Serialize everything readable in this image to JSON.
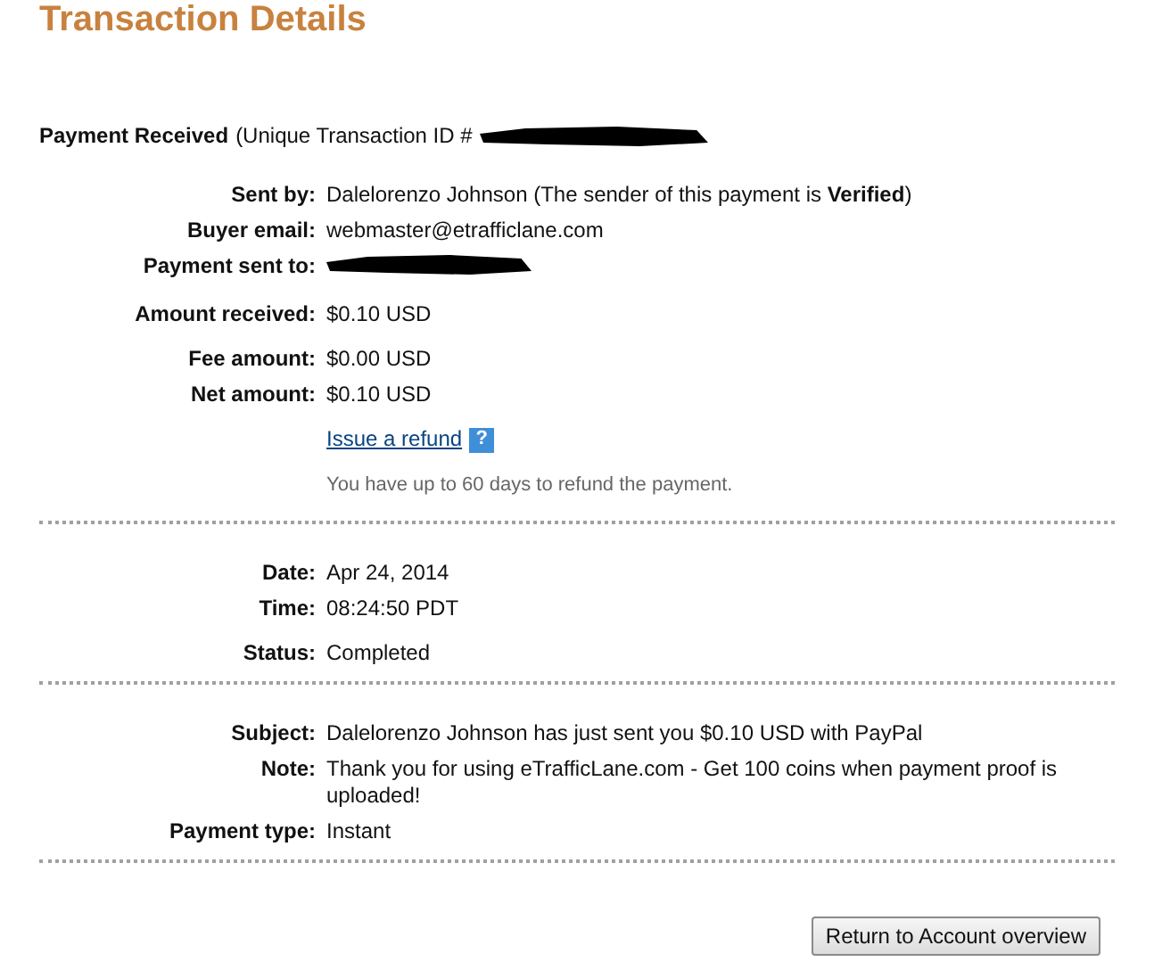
{
  "title": "Transaction Details",
  "header": {
    "label": "Payment Received",
    "text": "(Unique Transaction ID #",
    "redacted": true
  },
  "sections": [
    {
      "groups": [
        [
          {
            "label": "Sent by:",
            "kind": "text",
            "value": "Dalelorenzo Johnson (The sender of this payment is **Verified**)"
          },
          {
            "label": "Buyer email:",
            "kind": "text",
            "value": "webmaster@etrafficlane.com"
          },
          {
            "label": "Payment sent to:",
            "kind": "redacted"
          }
        ],
        [
          {
            "label": "Amount received:",
            "kind": "text",
            "value": "$0.10 USD"
          }
        ],
        [
          {
            "label": "Fee amount:",
            "kind": "text",
            "value": "$0.00 USD"
          },
          {
            "label": "Net amount:",
            "kind": "text",
            "value": "$0.10 USD"
          }
        ],
        [
          {
            "kind": "link",
            "value": "Issue a refund",
            "icon": "?"
          }
        ],
        [
          {
            "kind": "hint",
            "value": "You have up to 60 days to refund the payment."
          }
        ]
      ]
    },
    {
      "groups": [
        [
          {
            "label": "Date:",
            "kind": "text",
            "value": "Apr 24, 2014"
          },
          {
            "label": "Time:",
            "kind": "text",
            "value": "08:24:50 PDT"
          }
        ],
        [
          {
            "label": "Status:",
            "kind": "text",
            "value": "Completed"
          }
        ]
      ]
    },
    {
      "groups": [
        [
          {
            "label": "Subject:",
            "kind": "text",
            "value": "Dalelorenzo Johnson has just sent you $0.10 USD with PayPal"
          },
          {
            "label": "Note:",
            "kind": "text",
            "value": "Thank you for using eTrafficLane.com - Get 100 coins when payment proof is uploaded!"
          },
          {
            "label": "Payment type:",
            "kind": "text",
            "value": "Instant"
          }
        ]
      ]
    }
  ],
  "button": "Return to Account overview"
}
